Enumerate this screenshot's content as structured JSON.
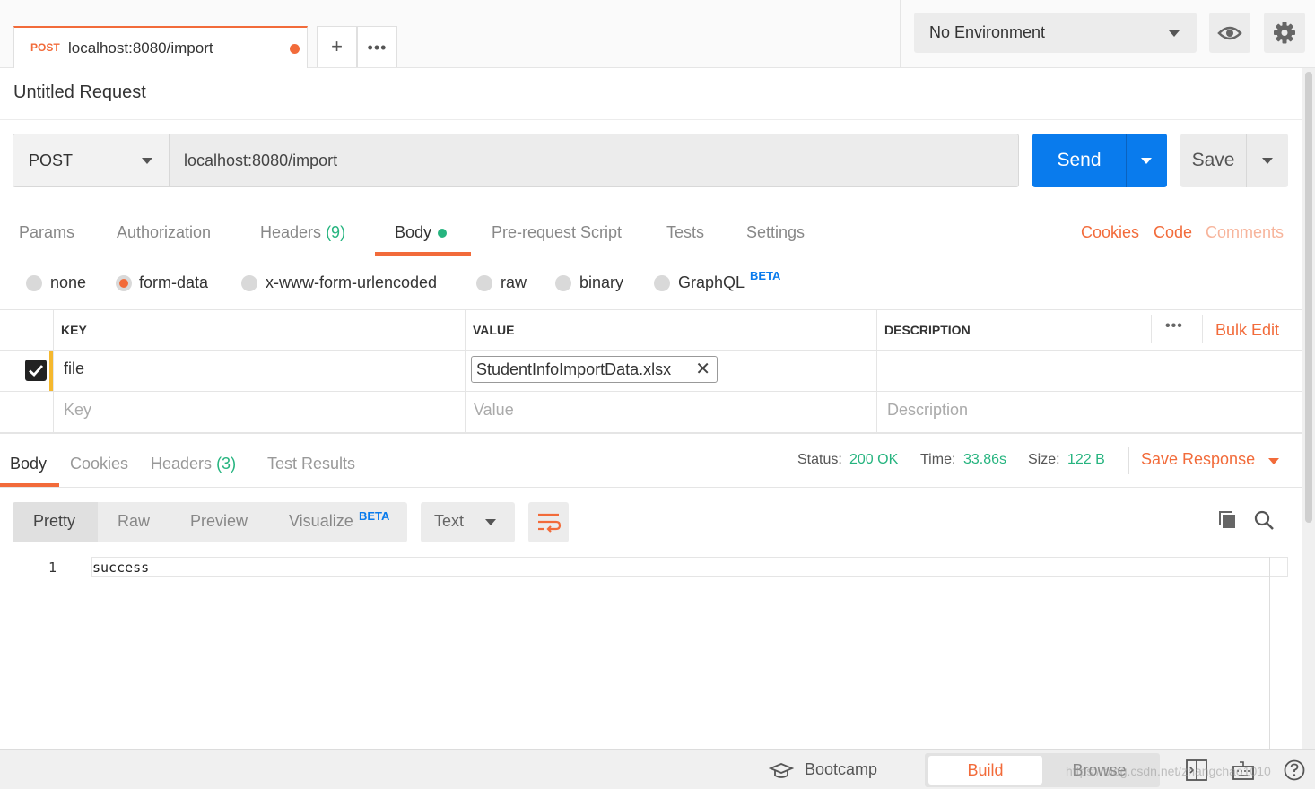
{
  "tab": {
    "method": "POST",
    "url": "localhost:8080/import",
    "add_icon": "plus-icon",
    "more_icon": "more-icon"
  },
  "environment": {
    "selected": "No Environment",
    "eye_icon": "eye-icon",
    "settings_icon": "gear-icon"
  },
  "request": {
    "title": "Untitled Request",
    "method": "POST",
    "url": "localhost:8080/import",
    "send_label": "Send",
    "save_label": "Save"
  },
  "request_tabs": {
    "params": "Params",
    "authorization": "Authorization",
    "headers": "Headers",
    "headers_count": "(9)",
    "body": "Body",
    "prerequest": "Pre-request Script",
    "tests": "Tests",
    "settings": "Settings",
    "cookies": "Cookies",
    "code": "Code",
    "comments": "Comments"
  },
  "body_types": {
    "none": "none",
    "form_data": "form-data",
    "urlencoded": "x-www-form-urlencoded",
    "raw": "raw",
    "binary": "binary",
    "graphql": "GraphQL",
    "beta": "BETA",
    "selected": "form-data"
  },
  "table": {
    "headers": {
      "key": "KEY",
      "value": "VALUE",
      "description": "DESCRIPTION",
      "bulk_edit": "Bulk Edit"
    },
    "rows": [
      {
        "key": "file",
        "value": "StudentInfoImportData.xlsx",
        "checked": true
      }
    ],
    "placeholders": {
      "key": "Key",
      "value": "Value",
      "description": "Description"
    }
  },
  "response_tabs": {
    "body": "Body",
    "cookies": "Cookies",
    "headers": "Headers",
    "headers_count": "(3)",
    "test_results": "Test Results"
  },
  "response_status": {
    "status_label": "Status:",
    "status_value": "200 OK",
    "time_label": "Time:",
    "time_value": "33.86s",
    "size_label": "Size:",
    "size_value": "122 B",
    "save_response": "Save Response"
  },
  "view_modes": {
    "pretty": "Pretty",
    "raw": "Raw",
    "preview": "Preview",
    "visualize": "Visualize",
    "beta": "BETA",
    "format": "Text"
  },
  "response_body": {
    "line_number": "1",
    "content": "success"
  },
  "footer": {
    "bootcamp": "Bootcamp",
    "build": "Build",
    "browse": "Browse",
    "watermark": "https://blog.csdn.net/zhangchao1010"
  },
  "colors": {
    "accent": "#f26b3a",
    "send": "#097bed",
    "success": "#26b47f",
    "beta": "#097bed"
  }
}
